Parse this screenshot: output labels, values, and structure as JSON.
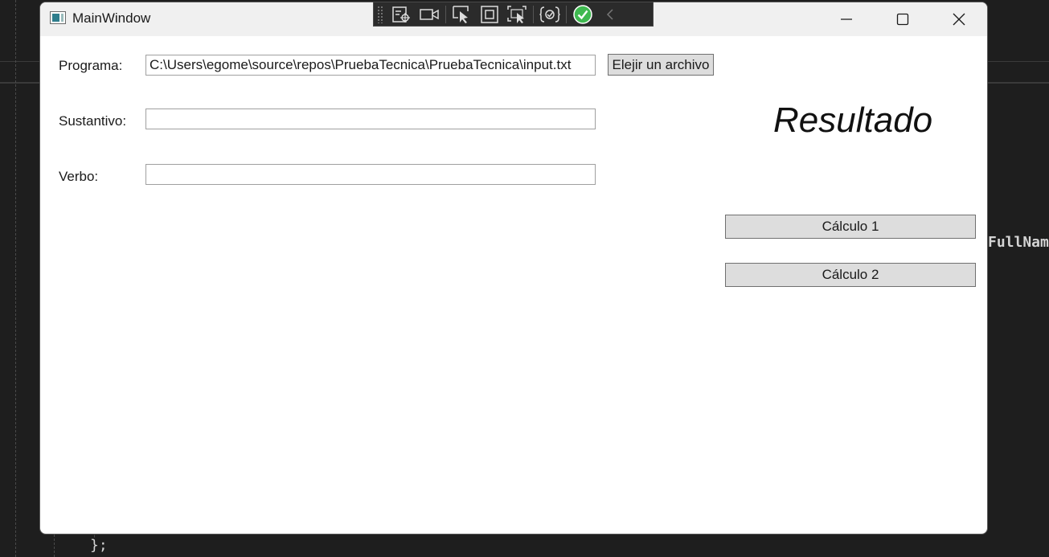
{
  "background": {
    "code_fragment_right": "FullNam",
    "code_fragment_bottom": "};"
  },
  "window": {
    "title": "MainWindow",
    "controls": {
      "minimize": "minimize-icon",
      "maximize": "maximize-icon",
      "close": "close-icon"
    }
  },
  "debug_toolbar": {
    "buttons": [
      "live-visual-tree-icon",
      "record-icon",
      "select-element-icon",
      "display-layout-icon",
      "track-focus-icon",
      "hot-reload-icon",
      "binding-check-icon",
      "collapse-icon"
    ],
    "accent_color": "#3fb950"
  },
  "form": {
    "programa_label": "Programa:",
    "programa_value": "C:\\Users\\egome\\source\\repos\\PruebaTecnica\\PruebaTecnica\\input.txt",
    "choose_file_label": "Elejir un archivo",
    "sustantivo_label": "Sustantivo:",
    "sustantivo_value": "",
    "verbo_label": "Verbo:",
    "verbo_value": ""
  },
  "result": {
    "title": "Resultado",
    "calc1_label": "Cálculo 1",
    "calc2_label": "Cálculo 2"
  }
}
